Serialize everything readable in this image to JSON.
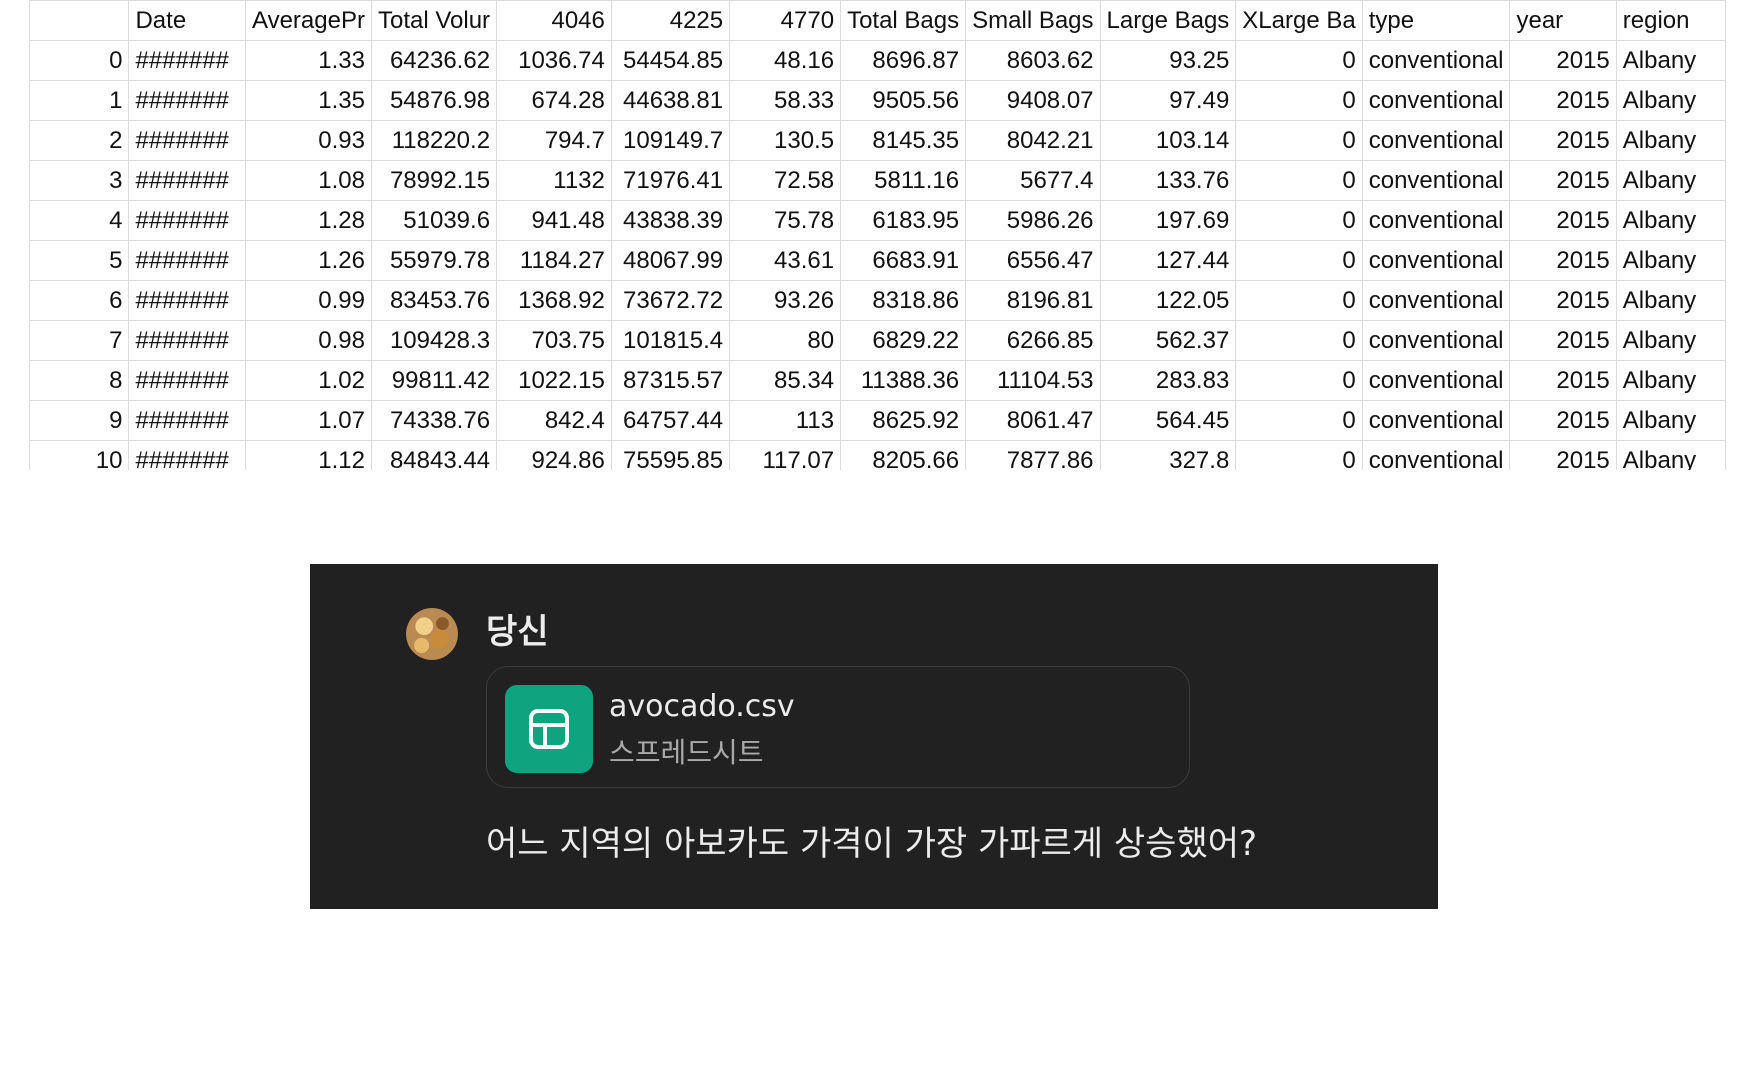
{
  "sheet": {
    "columns": [
      "",
      "Date",
      "AveragePr",
      "Total Volur",
      "4046",
      "4225",
      "4770",
      "Total Bags",
      "Small Bags",
      "Large Bags",
      "XLarge Ba",
      "type",
      "year",
      "region"
    ],
    "rows": [
      [
        "0",
        "#######",
        "1.33",
        "64236.62",
        "1036.74",
        "54454.85",
        "48.16",
        "8696.87",
        "8603.62",
        "93.25",
        "0",
        "conventional",
        "2015",
        "Albany"
      ],
      [
        "1",
        "#######",
        "1.35",
        "54876.98",
        "674.28",
        "44638.81",
        "58.33",
        "9505.56",
        "9408.07",
        "97.49",
        "0",
        "conventional",
        "2015",
        "Albany"
      ],
      [
        "2",
        "#######",
        "0.93",
        "118220.2",
        "794.7",
        "109149.7",
        "130.5",
        "8145.35",
        "8042.21",
        "103.14",
        "0",
        "conventional",
        "2015",
        "Albany"
      ],
      [
        "3",
        "#######",
        "1.08",
        "78992.15",
        "1132",
        "71976.41",
        "72.58",
        "5811.16",
        "5677.4",
        "133.76",
        "0",
        "conventional",
        "2015",
        "Albany"
      ],
      [
        "4",
        "#######",
        "1.28",
        "51039.6",
        "941.48",
        "43838.39",
        "75.78",
        "6183.95",
        "5986.26",
        "197.69",
        "0",
        "conventional",
        "2015",
        "Albany"
      ],
      [
        "5",
        "#######",
        "1.26",
        "55979.78",
        "1184.27",
        "48067.99",
        "43.61",
        "6683.91",
        "6556.47",
        "127.44",
        "0",
        "conventional",
        "2015",
        "Albany"
      ],
      [
        "6",
        "#######",
        "0.99",
        "83453.76",
        "1368.92",
        "73672.72",
        "93.26",
        "8318.86",
        "8196.81",
        "122.05",
        "0",
        "conventional",
        "2015",
        "Albany"
      ],
      [
        "7",
        "#######",
        "0.98",
        "109428.3",
        "703.75",
        "101815.4",
        "80",
        "6829.22",
        "6266.85",
        "562.37",
        "0",
        "conventional",
        "2015",
        "Albany"
      ],
      [
        "8",
        "#######",
        "1.02",
        "99811.42",
        "1022.15",
        "87315.57",
        "85.34",
        "11388.36",
        "11104.53",
        "283.83",
        "0",
        "conventional",
        "2015",
        "Albany"
      ],
      [
        "9",
        "#######",
        "1.07",
        "74338.76",
        "842.4",
        "64757.44",
        "113",
        "8625.92",
        "8061.47",
        "564.45",
        "0",
        "conventional",
        "2015",
        "Albany"
      ],
      [
        "10",
        "#######",
        "1.12",
        "84843.44",
        "924.86",
        "75595.85",
        "117.07",
        "8205.66",
        "7877.86",
        "327.8",
        "0",
        "conventional",
        "2015",
        "Albany"
      ]
    ]
  },
  "chat": {
    "user_name": "당신",
    "file": {
      "name": "avocado.csv",
      "kind": "스프레드시트",
      "icon": "spreadsheet-icon",
      "icon_color": "#10a37f"
    },
    "message": "어느 지역의 아보카도 가격이 가장 가파르게 상승했어?"
  }
}
